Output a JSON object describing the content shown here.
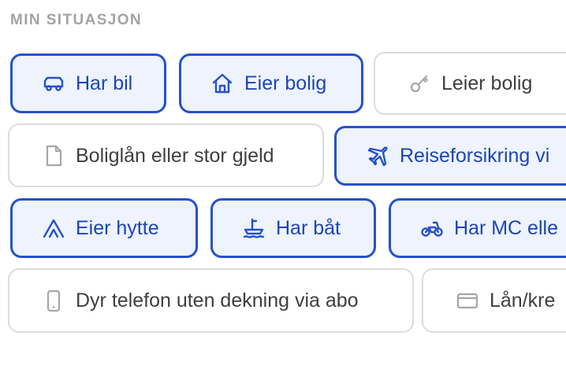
{
  "section": {
    "title": "MIN SITUASJON"
  },
  "colors": {
    "selected_border": "#2552c9",
    "selected_bg": "#eef3fd",
    "selected_text": "#1d45b6",
    "unselected_border": "#dcdcdc",
    "unselected_text": "#3f3f3f",
    "title_text": "#a3a3a3"
  },
  "options": [
    {
      "label": "Har bil",
      "icon": "car-icon",
      "selected": true
    },
    {
      "label": "Eier bolig",
      "icon": "house-icon",
      "selected": true
    },
    {
      "label": "Leier bolig",
      "icon": "key-icon",
      "selected": false
    },
    {
      "label": "Boliglån eller stor gjeld",
      "icon": "document-icon",
      "selected": false
    },
    {
      "label": "Reiseforsikring vi",
      "icon": "airplane-icon",
      "selected": true
    },
    {
      "label": "Eier hytte",
      "icon": "cabin-icon",
      "selected": true
    },
    {
      "label": "Har båt",
      "icon": "boat-icon",
      "selected": true
    },
    {
      "label": "Har MC elle",
      "icon": "motorcycle-icon",
      "selected": true
    },
    {
      "label": "Dyr telefon uten dekning via abo",
      "icon": "phone-icon",
      "selected": false
    },
    {
      "label": "Lån/kre",
      "icon": "credit-card-icon",
      "selected": false
    }
  ]
}
